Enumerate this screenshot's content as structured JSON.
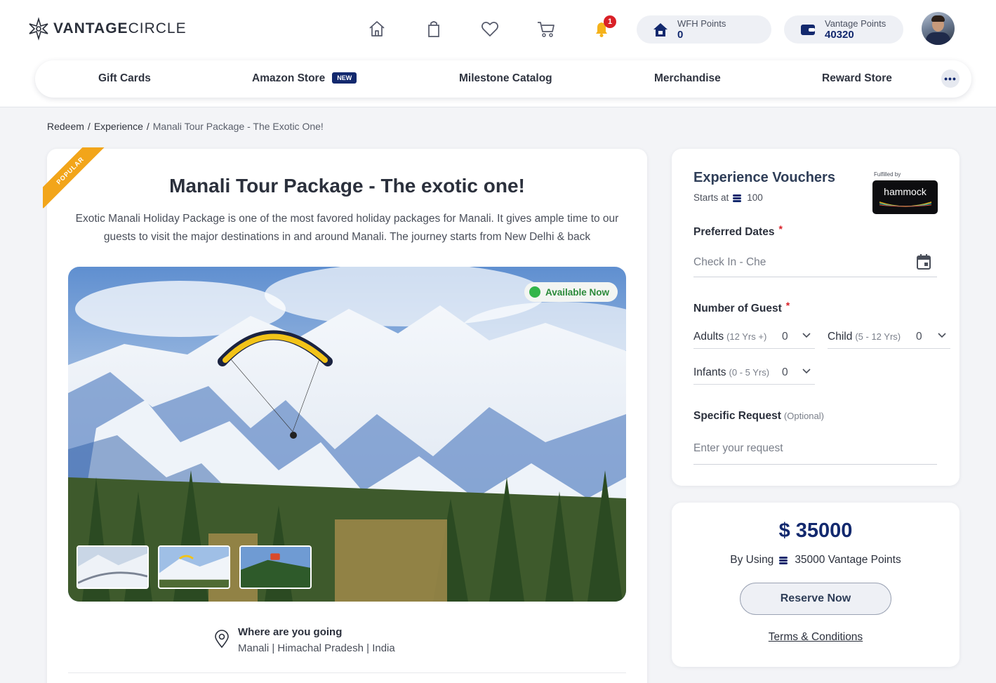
{
  "brand": {
    "name_bold": "VANTAGE",
    "name_light": "CIRCLE"
  },
  "header": {
    "icons": [
      "home-icon",
      "shopping-bag-icon",
      "heart-icon",
      "cart-icon",
      "bell-icon"
    ],
    "notification_count": "1",
    "wfh_points": {
      "label": "WFH Points",
      "value": "0"
    },
    "vantage_points": {
      "label": "Vantage Points",
      "value": "40320"
    }
  },
  "nav": {
    "items": [
      "Gift Cards",
      "Amazon Store",
      "Milestone Catalog",
      "Merchandise",
      "Reward Store"
    ],
    "new_badge": "NEW",
    "more": "•••"
  },
  "breadcrumb": {
    "items": [
      "Redeem",
      "Experience"
    ],
    "current": "Manali Tour Package - The Exotic One!",
    "separator": "/"
  },
  "package": {
    "ribbon": "POPULAR",
    "title": "Manali Tour Package - The exotic one!",
    "description": "Exotic Manali Holiday Package is one of the most favored holiday packages for Manali. It gives ample time to our guests to visit the major destinations in and around Manali. The journey starts from New Delhi & back",
    "availability": "Available Now",
    "where_label": "Where are you going",
    "where_value": "Manali | Himachal Pradesh | India"
  },
  "booking": {
    "title": "Experience Vouchers",
    "starts_at_label": "Starts at",
    "starts_at_value": "100",
    "fulfilled_by": "Fulfilled by",
    "partner": "hammock",
    "preferred_dates_label": "Preferred Dates",
    "date_placeholder": "Check In - Che",
    "guests_label": "Number of Guest",
    "adults": {
      "label": "Adults",
      "sub": "(12 Yrs +)",
      "value": "0"
    },
    "child": {
      "label": "Child",
      "sub": "(5 - 12 Yrs)",
      "value": "0"
    },
    "infants": {
      "label": "Infants",
      "sub": "(0 - 5 Yrs)",
      "value": "0"
    },
    "specific_request_label": "Specific Request",
    "specific_request_optional": "(Optional)",
    "request_placeholder": "Enter your request",
    "required_mark": "*"
  },
  "price": {
    "amount": "$ 35000",
    "using_prefix": "By Using",
    "using_value": "35000 Vantage Points",
    "reserve_label": "Reserve Now",
    "terms_label": "Terms & Conditions"
  },
  "colors": {
    "brand_navy": "#13296e",
    "ribbon": "#f2a51a",
    "available": "#33b54a",
    "badge_red": "#d92027"
  }
}
